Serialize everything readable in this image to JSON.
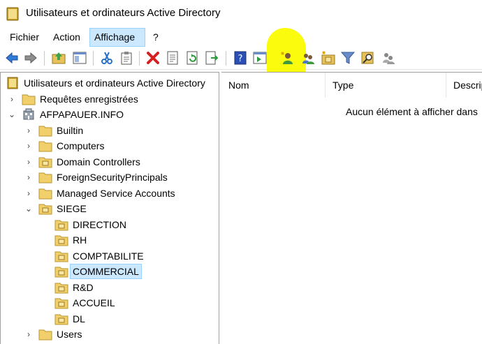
{
  "window": {
    "title": "Utilisateurs et ordinateurs Active Directory"
  },
  "menu": {
    "items": [
      "Fichier",
      "Action",
      "Affichage",
      "?"
    ],
    "active": "Affichage"
  },
  "toolbar": {
    "buttons": [
      "back-icon",
      "forward-icon",
      "up-folder-icon",
      "show-hide-tree-icon",
      "cut-icon",
      "clipboard-icon",
      "delete-icon",
      "properties-icon",
      "refresh-icon",
      "export-list-icon",
      "help-icon",
      "run-icon",
      "new-user-icon",
      "new-group-icon",
      "new-ou-icon",
      "filter-icon",
      "find-icon",
      "delegate-icon"
    ]
  },
  "tree": {
    "root": "Utilisateurs et ordinateurs Active Directory",
    "saved_queries": "Requêtes enregistrées",
    "domain": "AFPAPAUER.INFO",
    "containers": [
      "Builtin",
      "Computers",
      "Domain Controllers",
      "ForeignSecurityPrincipals",
      "Managed Service Accounts"
    ],
    "siege": "SIEGE",
    "siege_children": [
      "DIRECTION",
      "RH",
      "COMPTABILITE",
      "COMMERCIAL",
      "R&D",
      "ACCUEIL",
      "DL"
    ],
    "selected": "COMMERCIAL",
    "users": "Users"
  },
  "list": {
    "columns": [
      "Nom",
      "Type",
      "Descrip"
    ],
    "empty_message": "Aucun élément à afficher dans"
  },
  "colors": {
    "selection": "#cce8ff",
    "selection_border": "#99d1ff",
    "annotation": "#fbfb00"
  }
}
